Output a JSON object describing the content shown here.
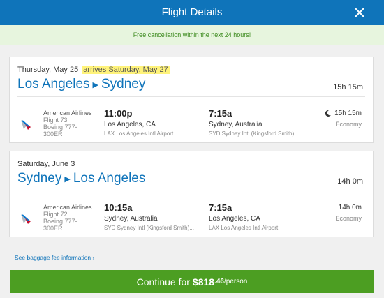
{
  "header": {
    "title": "Flight Details",
    "close_icon": "close-icon"
  },
  "banner": {
    "text": "Free cancellation within the next 24 hours!"
  },
  "outbound": {
    "date": "Thursday, May 25",
    "arrives": "arrives Saturday, May 27",
    "origin": "Los Angeles",
    "destination": "Sydney",
    "total_duration": "15h 15m",
    "leg": {
      "airline": "American Airlines",
      "flight": "Flight 73",
      "aircraft": "Boeing 777-300ER",
      "dep_time": "11:00p",
      "dep_city": "Los Angeles, CA",
      "dep_airport": "LAX Los Angeles Intl Airport",
      "arr_time": "7:15a",
      "arr_city": "Sydney, Australia",
      "arr_airport": "SYD Sydney Intl (Kingsford Smith)...",
      "duration": "15h 15m",
      "cabin": "Economy",
      "overnight_icon": "moon-icon"
    }
  },
  "return": {
    "date": "Saturday, June 3",
    "origin": "Sydney",
    "destination": "Los Angeles",
    "total_duration": "14h 0m",
    "leg": {
      "airline": "American Airlines",
      "flight": "Flight 72",
      "aircraft": "Boeing 777-300ER",
      "dep_time": "10:15a",
      "dep_city": "Sydney, Australia",
      "dep_airport": "SYD Sydney Intl (Kingsford Smith)...",
      "arr_time": "7:15a",
      "arr_city": "Los Angeles, CA",
      "arr_airport": "LAX Los Angeles Intl Airport",
      "duration": "14h 0m",
      "cabin": "Economy"
    }
  },
  "baggage_link": "See baggage fee information",
  "continue": {
    "label": "Continue for",
    "price": "$818",
    "cents": ".46",
    "per": "/person"
  },
  "colors": {
    "header": "#0f74ba",
    "banner_bg": "#e7f5de",
    "banner_text": "#3d8b1f",
    "continue_button": "#4c9e22",
    "arrives_highlight": "#fff37a"
  }
}
